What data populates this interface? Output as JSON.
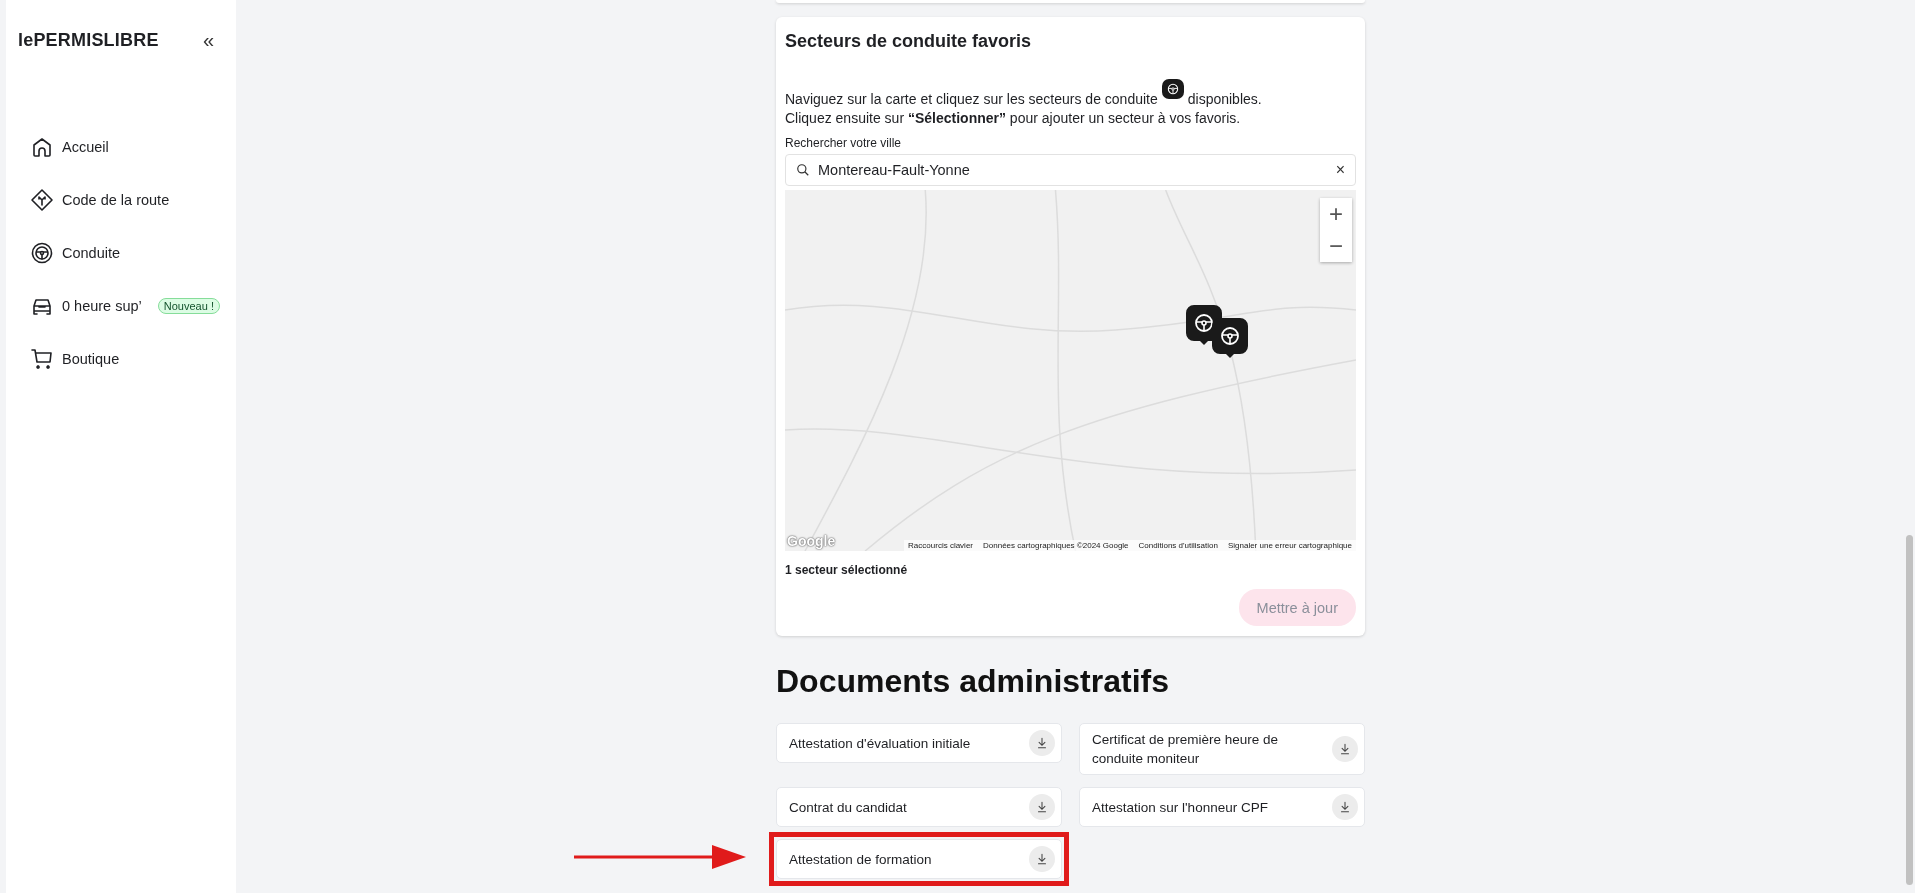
{
  "sidebar": {
    "logo": "lePERMISLIBRE",
    "collapse_label": "«",
    "items": [
      {
        "label": "Accueil",
        "selected": false
      },
      {
        "label": "Code de la route",
        "selected": false
      },
      {
        "label": "Conduite",
        "selected": false
      },
      {
        "label": "0 heure sup’",
        "badge": "Nouveau !",
        "selected": false
      },
      {
        "label": "Boutique",
        "selected": false
      }
    ]
  },
  "sectors_card": {
    "title": "Secteurs de conduite favoris",
    "intro_before_icon": "Naviguez sur la carte et cliquez sur les secteurs de conduite",
    "intro_after_icon": "disponibles.",
    "intro_line_2": "Cliquez ensuite sur **“Sélectionner”** pour ajouter un secteur à vos favoris.",
    "search": {
      "label": "Rechercher votre ville",
      "value": "Montereau-Fault-Yonne",
      "clear": "×"
    },
    "map": {
      "zoom_in": "+",
      "zoom_out": "−",
      "logo": "Google",
      "attribution": [
        "Raccourcis clavier",
        "Données cartographiques ©2024 Google",
        "Conditions d'utilisation",
        "Signaler une erreur cartographique"
      ]
    },
    "selection_count": "1 secteur sélectionné",
    "update_button": {
      "label": "Mettre à jour",
      "disabled": true
    }
  },
  "documents": {
    "title": "Documents administratifs",
    "items": [
      {
        "label": "Attestation d'évaluation initiale",
        "highlighted": false
      },
      {
        "label": "Certificat de première heure de conduite moniteur",
        "highlighted": false
      },
      {
        "label": "Contrat du candidat",
        "highlighted": false
      },
      {
        "label": "Attestation sur l'honneur CPF",
        "highlighted": false
      },
      {
        "label": "Attestation de formation",
        "highlighted": true
      }
    ],
    "annotation_arrow": true
  }
}
